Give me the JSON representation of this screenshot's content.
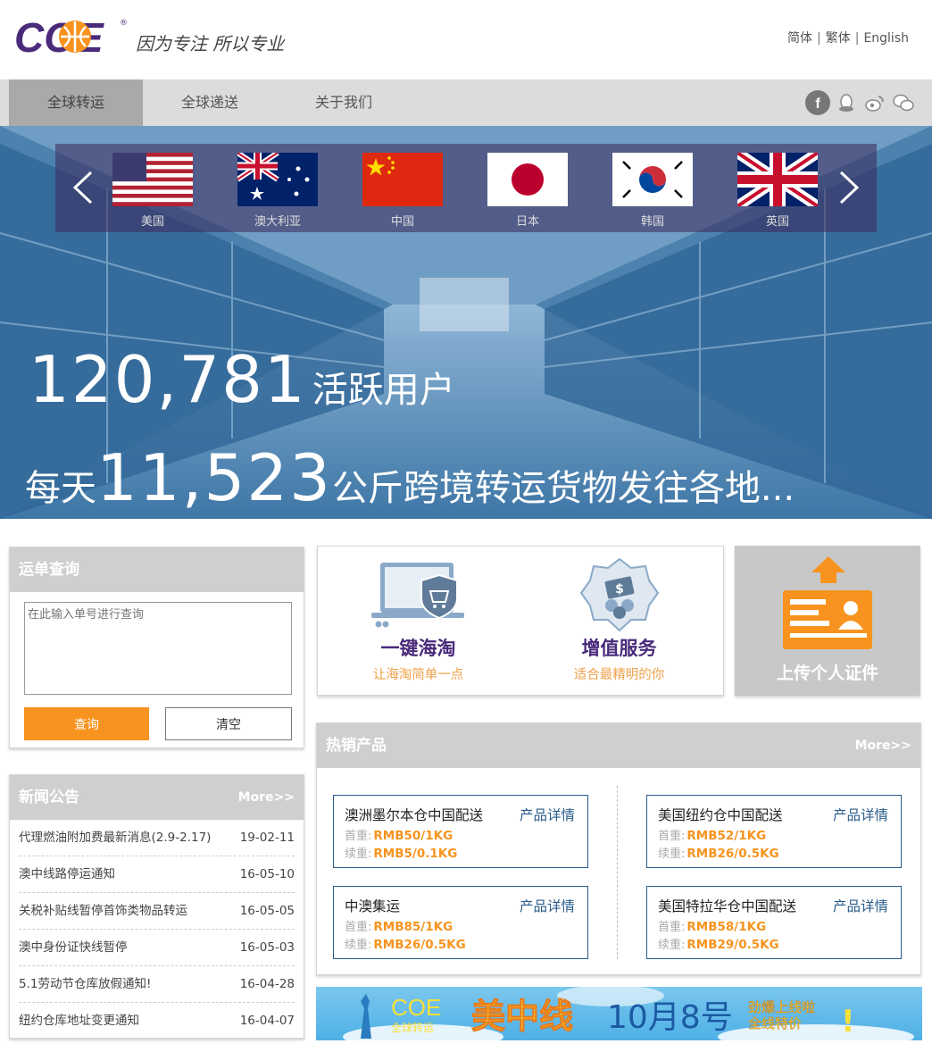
{
  "header": {
    "logo_text": "COE",
    "slogan": "因为专注 所以专业",
    "lang": [
      "简体",
      "繁体",
      "English"
    ]
  },
  "nav": {
    "items": [
      "全球转运",
      "全球递送",
      "关于我们"
    ],
    "social": [
      "facebook-icon",
      "qq-icon",
      "weibo-icon",
      "wechat-icon"
    ]
  },
  "carousel": {
    "countries": [
      "美国",
      "澳大利亚",
      "中国",
      "日本",
      "韩国",
      "英国"
    ]
  },
  "hero": {
    "active_users": "120,781",
    "active_users_label": "活跃用户",
    "daily_prefix": "每天",
    "daily_weight": "11,523",
    "daily_suffix": "公斤跨境转运货物发往各地..."
  },
  "tracking": {
    "title": "运单查询",
    "placeholder": "在此输入单号进行查询",
    "query_btn": "查询",
    "clear_btn": "清空"
  },
  "services": [
    {
      "title": "一键海淘",
      "sub": "让海淘简单一点"
    },
    {
      "title": "增值服务",
      "sub": "适合最精明的你"
    }
  ],
  "upload": {
    "label": "上传个人证件"
  },
  "hot": {
    "title": "热销产品",
    "more": "More>>",
    "detail_label": "产品详情",
    "first_label": "首重:",
    "cont_label": "续重:",
    "products": [
      {
        "name": "澳洲墨尔本仓中国配送",
        "first": "RMB50/1KG",
        "cont": "RMB5/0.1KG"
      },
      {
        "name": "美国纽约仓中国配送",
        "first": "RMB52/1KG",
        "cont": "RMB26/0.5KG"
      },
      {
        "name": "中澳集运",
        "first": "RMB85/1KG",
        "cont": "RMB26/0.5KG"
      },
      {
        "name": "美国特拉华仓中国配送",
        "first": "RMB58/1KG",
        "cont": "RMB29/0.5KG"
      }
    ]
  },
  "news": {
    "title": "新闻公告",
    "more": "More>>",
    "items": [
      {
        "title": "代理燃油附加费最新消息(2.9-2.17)",
        "date": "19-02-11"
      },
      {
        "title": "澳中线路停运通知",
        "date": "16-05-10"
      },
      {
        "title": "关税补贴线暂停首饰类物品转运",
        "date": "16-05-05"
      },
      {
        "title": "澳中身份证快线暂停",
        "date": "16-05-03"
      },
      {
        "title": "5.1劳动节仓库放假通知!",
        "date": "16-04-28"
      },
      {
        "title": "纽约仓库地址变更通知",
        "date": "16-04-07"
      }
    ]
  },
  "banner": {
    "brand": "COE",
    "brand_sub": "全球转运",
    "main": "美中线",
    "date": "10月8号",
    "line1": "劲爆上线啦",
    "line2": "全线特价"
  },
  "colors": {
    "orange": "#f7931e",
    "purple": "#4a2a7a",
    "nav_bg": "#dcdcdc",
    "link_blue": "#2a5c8a"
  }
}
